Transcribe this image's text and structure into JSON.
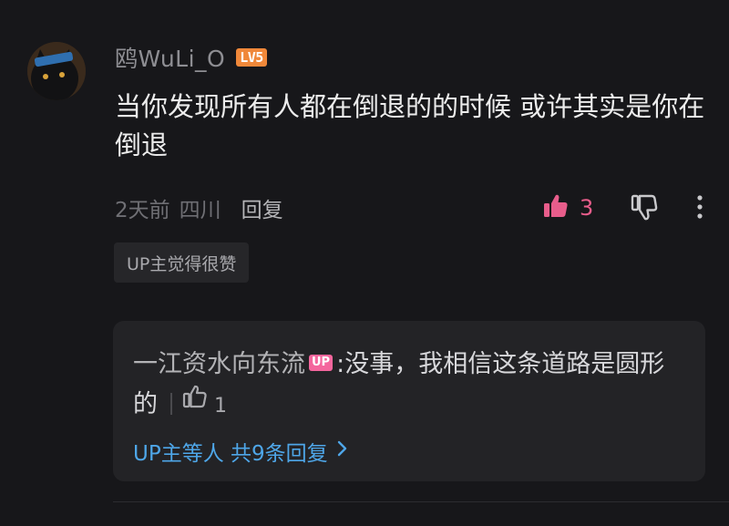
{
  "comment": {
    "username": "鸥WuLi_O",
    "level_badge": "LV5",
    "text": "当你发现所有人都在倒退的的时候 或许其实是你在倒退",
    "time": "2天前",
    "location": "四川",
    "reply_label": "回复",
    "like_count": "3",
    "up_liked_tag": "UP主觉得很赞"
  },
  "reply": {
    "author": "一江资水向东流",
    "author_badge": "UP",
    "colon": ":",
    "text": "没事，我相信这条道路是圆形的",
    "like_count": "1",
    "more_replies_label": "UP主等人 共9条回复"
  },
  "colors": {
    "background": "#17171a",
    "like_active": "#e85d8b",
    "link_blue": "#4ea6e8",
    "level_badge": "#f0883a",
    "up_badge": "#f4669d"
  },
  "icons": {
    "like": "thumbs-up-filled-icon",
    "dislike": "thumbs-down-icon",
    "more": "vertical-ellipsis-icon",
    "reply_like": "thumbs-up-outline-icon",
    "chevron": "chevron-right-icon"
  }
}
